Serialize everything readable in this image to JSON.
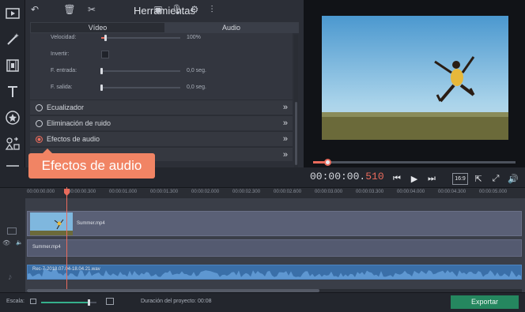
{
  "tools": {
    "title": "Herramientas",
    "tabs": [
      {
        "label": "Vídeo",
        "active": false
      },
      {
        "label": "Audio",
        "active": true
      }
    ],
    "settings": {
      "speed": {
        "label": "Velocidad:",
        "value": "100%",
        "level": 0.05
      },
      "invert": {
        "label": "Invertir:",
        "checked": false
      },
      "fade_in": {
        "label": "F. entrada:",
        "value": "0,0 seg.",
        "level": 0.0
      },
      "fade_out": {
        "label": "F. salida:",
        "value": "0,0 seg.",
        "level": 0.0
      }
    },
    "categories": [
      {
        "label": "Ecualizador",
        "selected": false
      },
      {
        "label": "Eliminación de ruido",
        "selected": false
      },
      {
        "label": "Efectos de audio",
        "selected": true
      }
    ],
    "tooltip": "Efectos de audio"
  },
  "preview": {
    "timecode_main": "00:00:00.",
    "timecode_ms": "510",
    "seek_progress": 0.07,
    "aspect_ratio": "16:9"
  },
  "ruler": {
    "ticks": [
      "00:00:00.000",
      "00:00:00.300",
      "00:00:00.600",
      "00:00:01.000",
      "00:00:01.300",
      "00:00:01.600",
      "00:00:02.000",
      "00:00:02.300",
      "00:00:02.600",
      "00:00:03.000",
      "00:00:03.300",
      "00:00:03.600",
      "00:00:04.000",
      "00:00:04.300",
      "00:00:04.600",
      "00:00:05.000",
      "00:00:05.300"
    ]
  },
  "timeline": {
    "video_clip": "Summer.mp4",
    "title_clip": "Summer.mp4",
    "audio_clip": "Rec-7-2018.07.04-18.04.21.wav"
  },
  "bottom": {
    "scale_label": "Escala:",
    "scale_level": 0.85,
    "duration_label": "Duración del proyecto:",
    "duration_value": "00:08",
    "export_label": "Exportar"
  },
  "colors": {
    "accent": "#e96b5c",
    "export": "#25875f",
    "audio": "#3a6fa8"
  }
}
